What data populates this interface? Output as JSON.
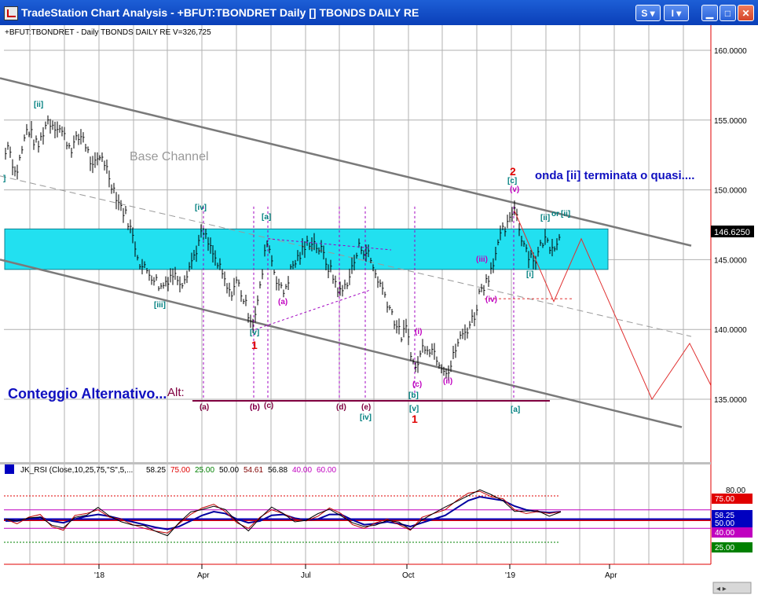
{
  "window": {
    "title": "TradeStation Chart Analysis - +BFUT:TBONDRET Daily [] TBONDS DAILY RE",
    "buttons": {
      "s_label": "S ▾",
      "i_label": "I ▾"
    }
  },
  "chart": {
    "header": "+BFUT:TBONDRET - Daily  TBONDS DAILY RE  V=326,725",
    "last_price_label": "146.6250",
    "annotations": {
      "base_channel": "Base Channel",
      "onda": "onda [ii] terminata o quasi....",
      "conteggio": "Conteggio Alternativo...",
      "alt": "Alt:"
    },
    "wave_labels": [
      {
        "text": "[ii]",
        "color": "#008080"
      },
      {
        "text": "[iv]",
        "color": "#008080"
      },
      {
        "text": "[iii]",
        "color": "#008080"
      },
      {
        "text": "[a]",
        "color": "#008080"
      },
      {
        "text": "[v]",
        "color": "#008080"
      },
      {
        "text": "1",
        "color": "#e00000"
      },
      {
        "text": "(a)",
        "color": "#c000c0"
      },
      {
        "text": "(b)",
        "color": "#c000c0"
      },
      {
        "text": "(i)",
        "color": "#c000c0"
      },
      {
        "text": "(c)",
        "color": "#c000c0"
      },
      {
        "text": "[b]",
        "color": "#008080"
      },
      {
        "text": "[v]",
        "color": "#008080"
      },
      {
        "text": "1",
        "color": "#e00000"
      },
      {
        "text": "(ii)",
        "color": "#c000c0"
      },
      {
        "text": "(iii)",
        "color": "#c000c0"
      },
      {
        "text": "(iv)",
        "color": "#c000c0"
      },
      {
        "text": "2",
        "color": "#e00000"
      },
      {
        "text": "[c]",
        "color": "#008080"
      },
      {
        "text": "(v)",
        "color": "#c000c0"
      },
      {
        "text": "[ii]",
        "color": "#008080"
      },
      {
        "text": "or",
        "color": "#008080"
      },
      {
        "text": "[ii]",
        "color": "#008080"
      },
      {
        "text": "[i]",
        "color": "#008080"
      },
      {
        "text": "[a]",
        "color": "#008080"
      },
      {
        "text": "(a)",
        "color": "#800040"
      },
      {
        "text": "(b)",
        "color": "#800040"
      },
      {
        "text": "(c)",
        "color": "#800040"
      },
      {
        "text": "(d)",
        "color": "#800040"
      },
      {
        "text": "(e)",
        "color": "#800040"
      },
      {
        "text": "[iv]",
        "color": "#008080"
      },
      {
        "text": "]",
        "color": "#008080"
      }
    ],
    "indicator_header": "JK_RSI (Close,10,25,75,\"S\",5,...",
    "indicator_values": [
      {
        "text": "58.25",
        "color": "#000000"
      },
      {
        "text": "75.00",
        "color": "#e00000"
      },
      {
        "text": "25.00",
        "color": "#008000"
      },
      {
        "text": "50.00",
        "color": "#000000"
      },
      {
        "text": "54.61",
        "color": "#800000"
      },
      {
        "text": "56.88",
        "color": "#000000"
      },
      {
        "text": "40.00",
        "color": "#c000c0"
      },
      {
        "text": "60.00",
        "color": "#c000c0"
      }
    ],
    "right_badges": [
      {
        "text": "58.25",
        "bg": "#0000c0",
        "fg": "#ffffff"
      },
      {
        "text": "75.00",
        "bg": "#e00000",
        "fg": "#ffffff"
      },
      {
        "text": "50.00",
        "bg": "#0000c0",
        "fg": "#ffffff"
      },
      {
        "text": "40.00",
        "bg": "#c000c0",
        "fg": "#ffffff"
      },
      {
        "text": "25.00",
        "bg": "#008000",
        "fg": "#ffffff"
      }
    ]
  },
  "chart_data": {
    "type": "bar",
    "title": "+BFUT:TBONDRET - Daily  TBONDS DAILY RE  V=326,725",
    "x_tick_labels": [
      "'18",
      "Apr",
      "Jul",
      "Oct",
      "'19",
      "Apr"
    ],
    "y_tick_labels": [
      "160.0000",
      "155.0000",
      "150.0000",
      "145.0000",
      "140.0000",
      "135.0000"
    ],
    "ylim": [
      132,
      162
    ],
    "last_value": 146.625,
    "price_path": [
      [
        0,
        150.5
      ],
      [
        10,
        153.5
      ],
      [
        20,
        151
      ],
      [
        35,
        154.5
      ],
      [
        48,
        153
      ],
      [
        60,
        155
      ],
      [
        75,
        154.5
      ],
      [
        90,
        153
      ],
      [
        105,
        154
      ],
      [
        118,
        151.5
      ],
      [
        130,
        152.5
      ],
      [
        142,
        150.5
      ],
      [
        152,
        149
      ],
      [
        162,
        148
      ],
      [
        172,
        146
      ],
      [
        180,
        144.5
      ],
      [
        192,
        144
      ],
      [
        205,
        143
      ],
      [
        218,
        144
      ],
      [
        232,
        143.5
      ],
      [
        245,
        145
      ],
      [
        258,
        147
      ],
      [
        270,
        145.5
      ],
      [
        282,
        144
      ],
      [
        292,
        142.5
      ],
      [
        302,
        143.5
      ],
      [
        314,
        141.5
      ],
      [
        322,
        140.5
      ],
      [
        330,
        142.5
      ],
      [
        340,
        146.5
      ],
      [
        350,
        144
      ],
      [
        360,
        142.5
      ],
      [
        372,
        144.5
      ],
      [
        384,
        145.5
      ],
      [
        396,
        146.5
      ],
      [
        410,
        145.5
      ],
      [
        422,
        144
      ],
      [
        434,
        142.5
      ],
      [
        446,
        144
      ],
      [
        458,
        146
      ],
      [
        468,
        145.5
      ],
      [
        478,
        144
      ],
      [
        490,
        142.5
      ],
      [
        500,
        141
      ],
      [
        510,
        139.5
      ],
      [
        518,
        140
      ],
      [
        528,
        137
      ],
      [
        540,
        139
      ],
      [
        552,
        138.5
      ],
      [
        562,
        137.5
      ],
      [
        572,
        137
      ],
      [
        582,
        139
      ],
      [
        594,
        140
      ],
      [
        604,
        141
      ],
      [
        612,
        143
      ],
      [
        620,
        143.5
      ],
      [
        628,
        145
      ],
      [
        640,
        147
      ],
      [
        648,
        147.5
      ],
      [
        655,
        149
      ],
      [
        662,
        147
      ],
      [
        672,
        145.5
      ],
      [
        682,
        145
      ],
      [
        692,
        146.5
      ],
      [
        702,
        146
      ],
      [
        714,
        146.6
      ]
    ],
    "upper_channel": [
      [
        0,
        158
      ],
      [
        880,
        146
      ]
    ],
    "lower_channel": [
      [
        0,
        145
      ],
      [
        868,
        133
      ]
    ],
    "mid_channel": [
      [
        0,
        151
      ],
      [
        880,
        139.5
      ]
    ],
    "forecast_path": [
      [
        655,
        148.5
      ],
      [
        705,
        142
      ],
      [
        740,
        146.5
      ],
      [
        830,
        135
      ],
      [
        878,
        139
      ],
      [
        905,
        136
      ]
    ],
    "rsi_fast": [
      50,
      45,
      52,
      55,
      42,
      38,
      54,
      56,
      60,
      52,
      50,
      44,
      40,
      37,
      35,
      45,
      55,
      62,
      66,
      58,
      46,
      40,
      52,
      60,
      56,
      50,
      48,
      53,
      62,
      56,
      44,
      40,
      46,
      50,
      44,
      38,
      52,
      56,
      60,
      70,
      78,
      80,
      74,
      72,
      60,
      56,
      58,
      56,
      58
    ],
    "rsi_slow": [
      48,
      48,
      50,
      52,
      48,
      46,
      50,
      53,
      55,
      53,
      50,
      47,
      44,
      41,
      39,
      42,
      48,
      54,
      58,
      56,
      50,
      46,
      48,
      54,
      55,
      51,
      49,
      50,
      55,
      55,
      49,
      44,
      45,
      47,
      45,
      42,
      46,
      50,
      54,
      62,
      70,
      74,
      72,
      70,
      64,
      60,
      58,
      57,
      58
    ],
    "rsi_levels": {
      "upper": 75,
      "mid": 50,
      "lower": 25,
      "band_low": 40,
      "band_high": 60
    }
  }
}
